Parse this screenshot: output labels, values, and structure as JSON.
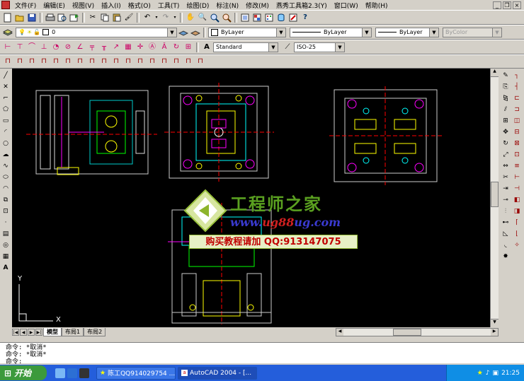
{
  "menu": {
    "items": [
      "文件(F)",
      "编辑(E)",
      "视图(V)",
      "插入(I)",
      "格式(O)",
      "工具(T)",
      "绘图(D)",
      "标注(N)",
      "修改(M)",
      "燕秀工具箱2.3(Y)",
      "窗口(W)",
      "帮助(H)"
    ]
  },
  "layer": {
    "current": "0"
  },
  "properties": {
    "color": "ByLayer",
    "linetype": "ByLayer",
    "lineweight": "ByLayer",
    "plotstyle": "ByColor"
  },
  "styles": {
    "text_style": "Standard",
    "dim_style": "ISO-25"
  },
  "layout_tabs": [
    "模型",
    "布局1",
    "布局2"
  ],
  "command_lines": [
    "命令: *取消*",
    "命令: *取消*",
    "命令:"
  ],
  "watermark": {
    "title": "工程师之家",
    "url_prefix": "www.",
    "url_highlight": "ug88",
    "url_suffix": "ug.com",
    "promo": "购买教程请加 QQ:913147075"
  },
  "taskbar": {
    "start_label": "开始",
    "tasks": [
      "陈工QQ914029754 ...",
      "AutoCAD 2004 - [..."
    ],
    "clock": "21:25"
  },
  "ucs": {
    "x_label": "X",
    "y_label": "Y"
  }
}
